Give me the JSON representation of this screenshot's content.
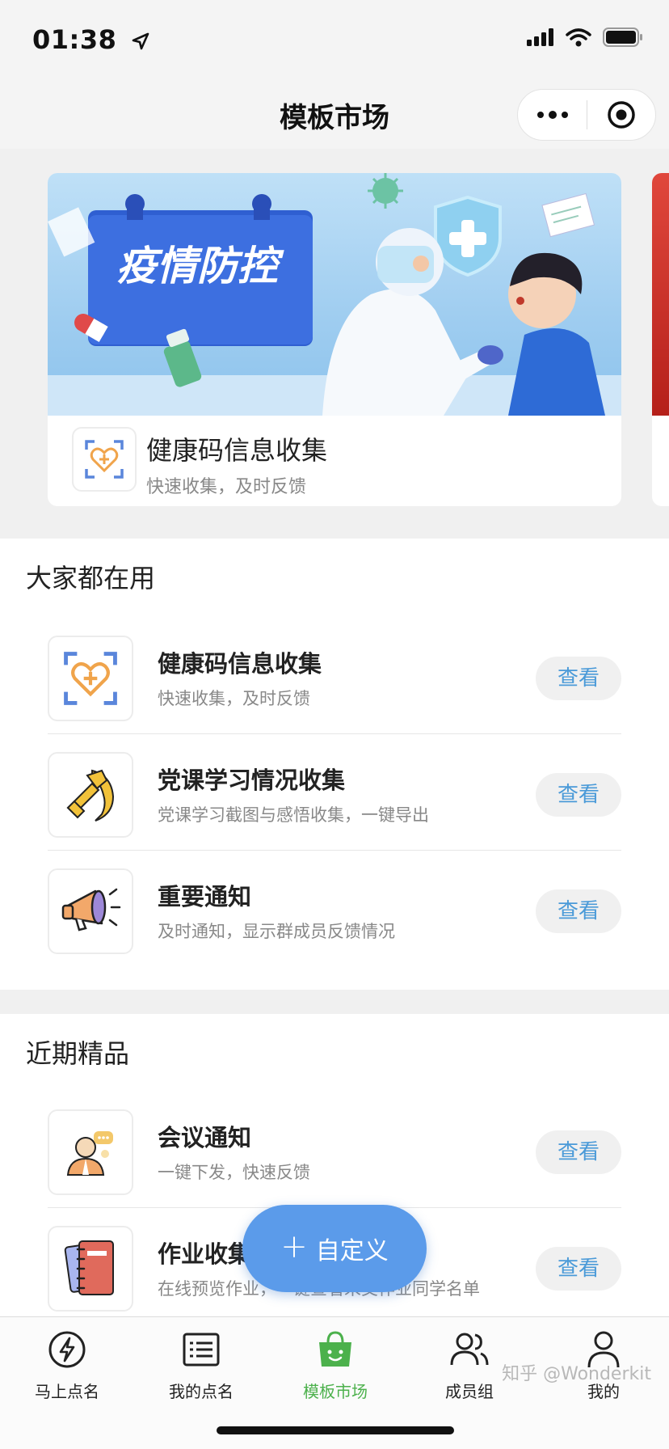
{
  "status_bar": {
    "time": "01:38"
  },
  "nav": {
    "title": "模板市场"
  },
  "banner": {
    "image_text": "疫情防控",
    "caption_title": "健康码信息收集",
    "caption_sub": "快速收集，及时反馈"
  },
  "sections": [
    {
      "title": "大家都在用",
      "items": [
        {
          "title": "健康码信息收集",
          "sub": "快速收集，及时反馈",
          "icon": "health-code-icon",
          "button": "查看"
        },
        {
          "title": "党课学习情况收集",
          "sub": "党课学习截图与感悟收集，一键导出",
          "icon": "party-emblem-icon",
          "button": "查看"
        },
        {
          "title": "重要通知",
          "sub": "及时通知，显示群成员反馈情况",
          "icon": "megaphone-icon",
          "button": "查看"
        }
      ]
    },
    {
      "title": "近期精品",
      "items": [
        {
          "title": "会议通知",
          "sub": "一键下发，快速反馈",
          "icon": "meeting-icon",
          "button": "查看"
        },
        {
          "title": "作业收集",
          "sub": "在线预览作业，一键查看未交作业同学名单",
          "icon": "notebook-icon",
          "button": "查看"
        }
      ]
    }
  ],
  "fab": {
    "label": "自定义"
  },
  "tabs": [
    {
      "label": "马上点名",
      "icon": "lightning-icon",
      "active": false
    },
    {
      "label": "我的点名",
      "icon": "list-icon",
      "active": false
    },
    {
      "label": "模板市场",
      "icon": "shopping-bag-icon",
      "active": true
    },
    {
      "label": "成员组",
      "icon": "members-icon",
      "active": false
    },
    {
      "label": "我的",
      "icon": "user-icon",
      "active": false
    }
  ],
  "watermark": "知乎 @Wonderkit",
  "colors": {
    "accent_green": "#4cb14c",
    "button_text_blue": "#4a9ad8",
    "fab_blue": "#5b9bea"
  }
}
